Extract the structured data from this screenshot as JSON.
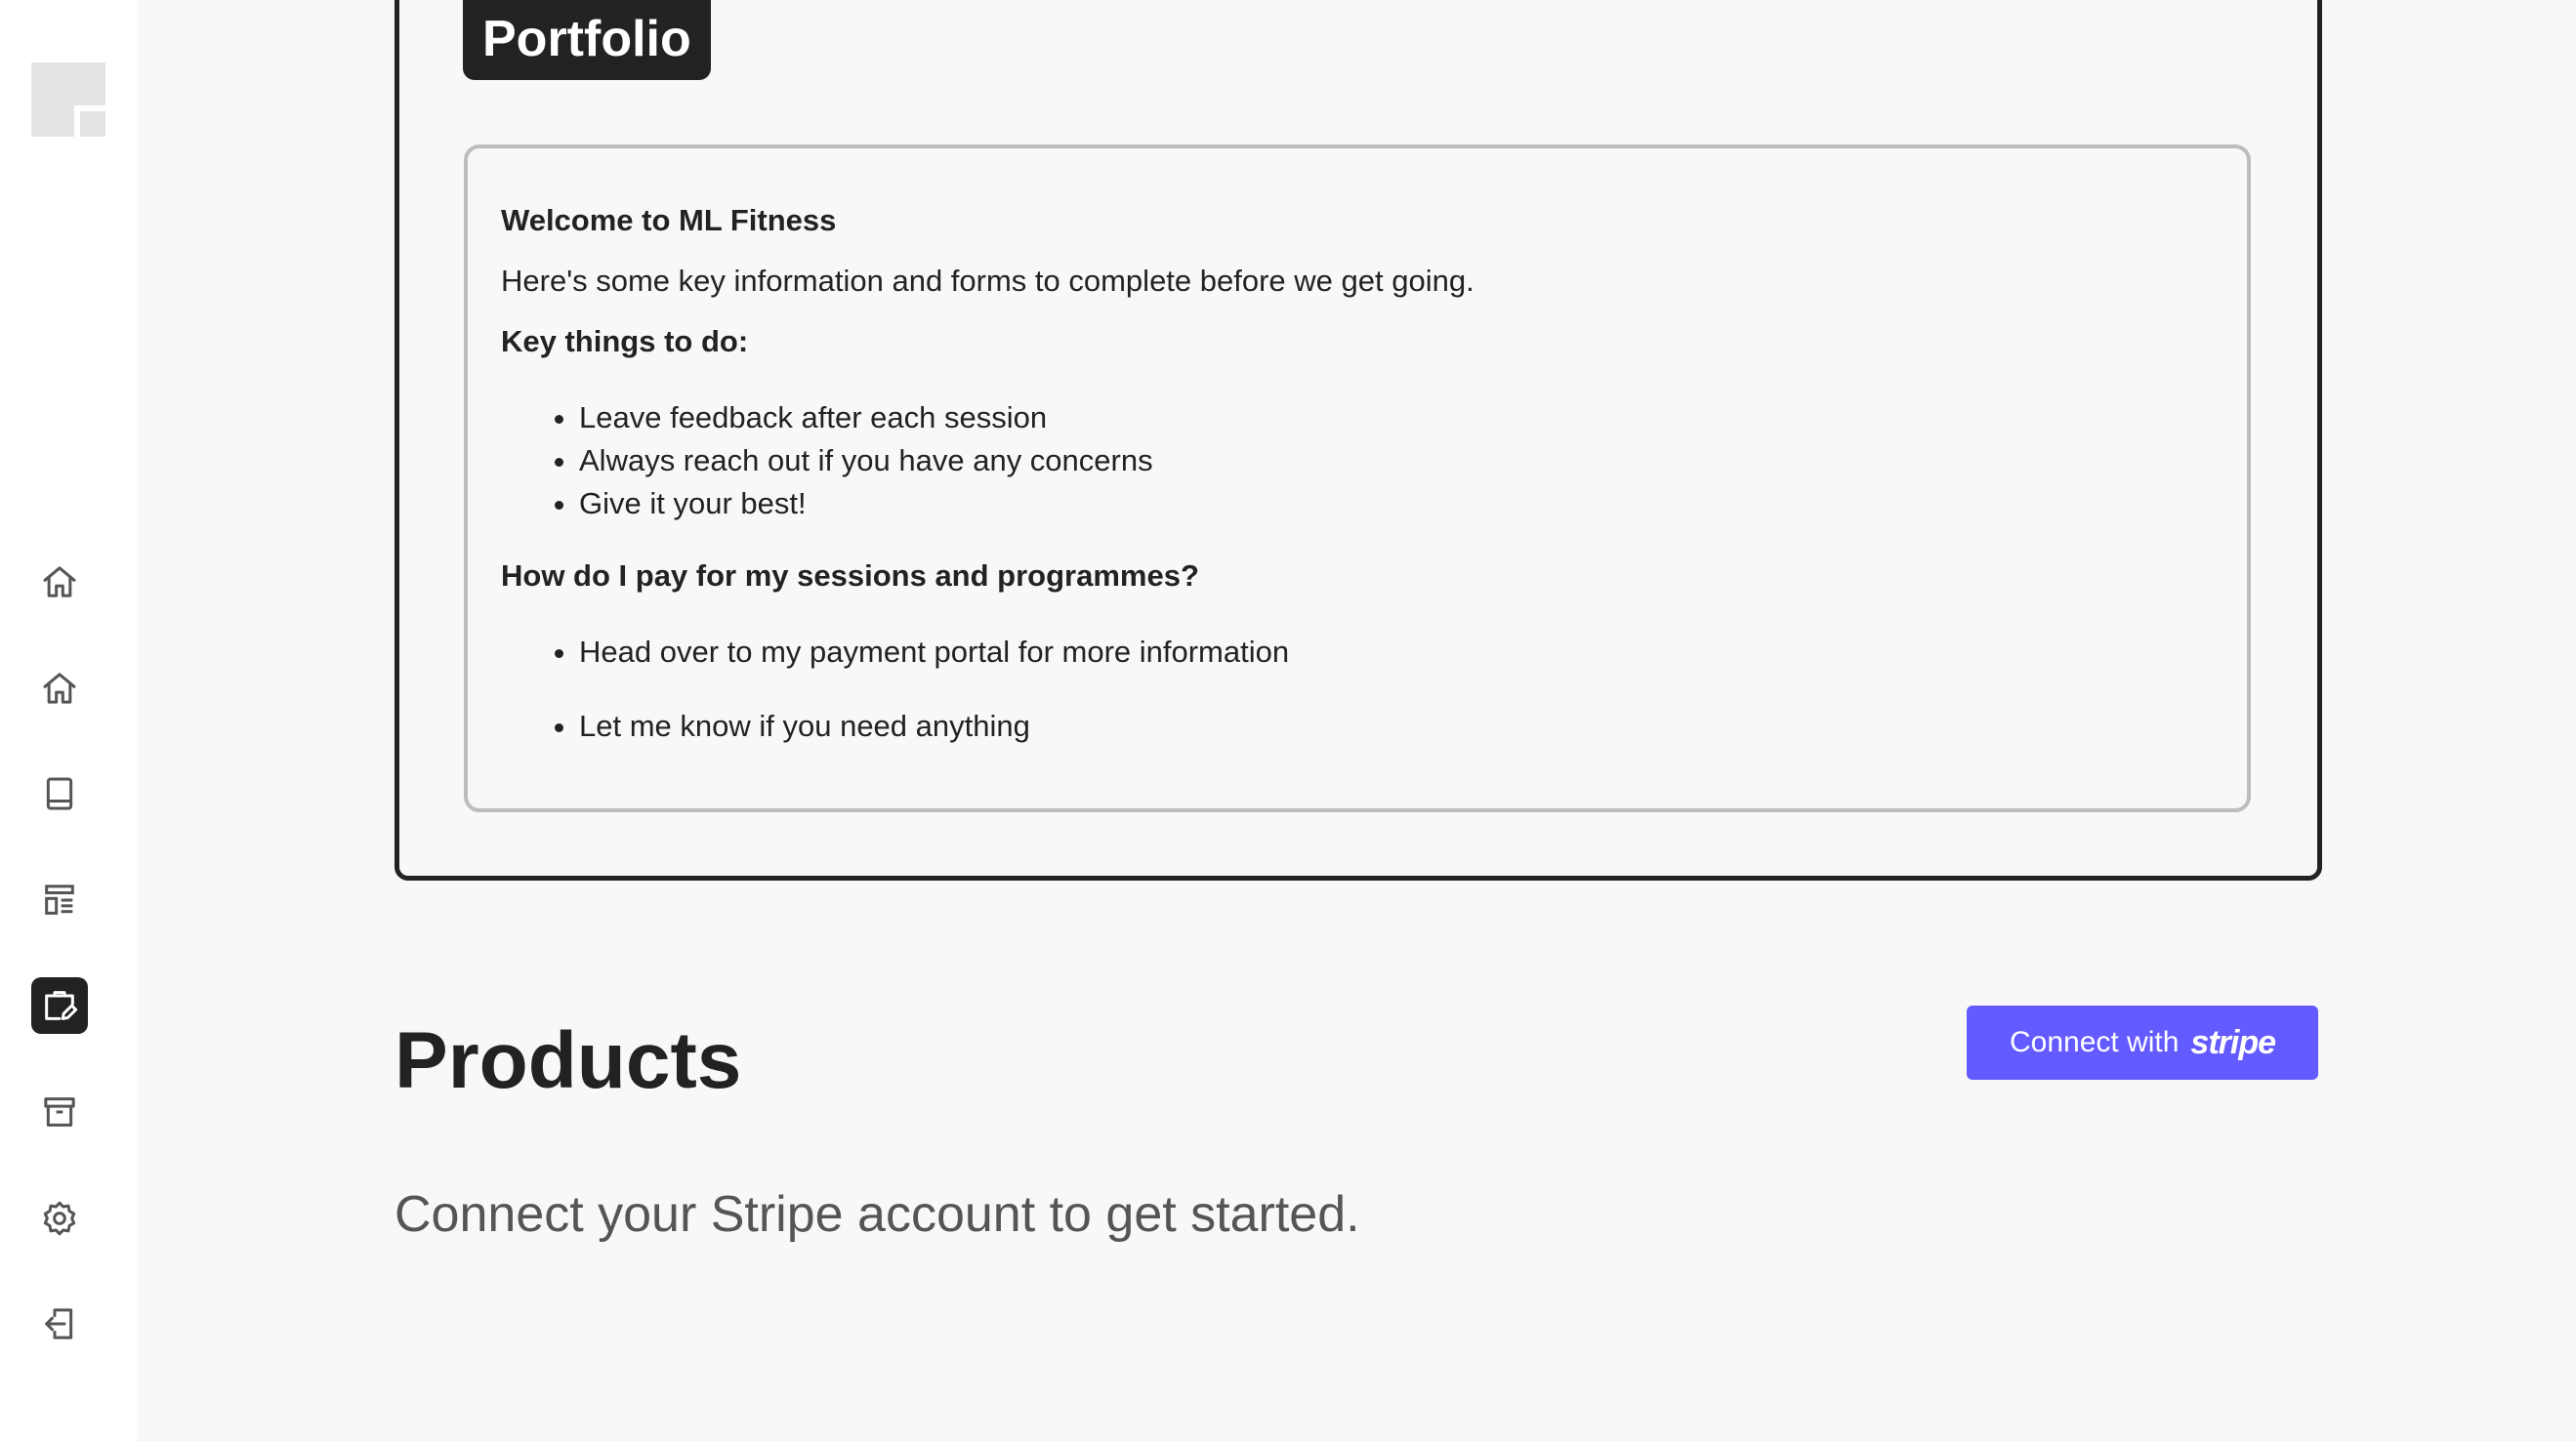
{
  "sidebar": {
    "logo_icon": "app-logo-icon",
    "items": [
      {
        "icon": "home-icon",
        "active": false
      },
      {
        "icon": "home-outline-icon",
        "active": false
      },
      {
        "icon": "book-icon",
        "active": false
      },
      {
        "icon": "layout-list-icon",
        "active": false
      },
      {
        "icon": "briefcase-edit-icon",
        "active": true
      },
      {
        "icon": "archive-icon",
        "active": false
      },
      {
        "icon": "settings-gear-icon",
        "active": false
      },
      {
        "icon": "logout-icon",
        "active": false
      }
    ]
  },
  "portfolio": {
    "tag_label": "Portfolio",
    "card": {
      "title": "Welcome to ML Fitness",
      "intro": "Here's some key information and forms to complete before we get going.",
      "key_heading": "Key things to do:",
      "key_items": [
        "Leave feedback after each session",
        "Always reach out if you have any concerns",
        "Give it your best!"
      ],
      "pay_heading": "How do I pay for my sessions and programmes?",
      "pay_items": [
        "Head over to my payment portal for more information",
        "Let me know if you need anything"
      ]
    }
  },
  "products": {
    "title": "Products",
    "connect_label": "Connect with",
    "connect_brand": "stripe",
    "subtitle": "Connect your Stripe account to get started."
  },
  "colors": {
    "accent_stripe": "#635bff",
    "dark": "#222222",
    "background": "#f8f8f8",
    "sidebar_bg": "#ffffff",
    "icon_gray": "#555555"
  }
}
